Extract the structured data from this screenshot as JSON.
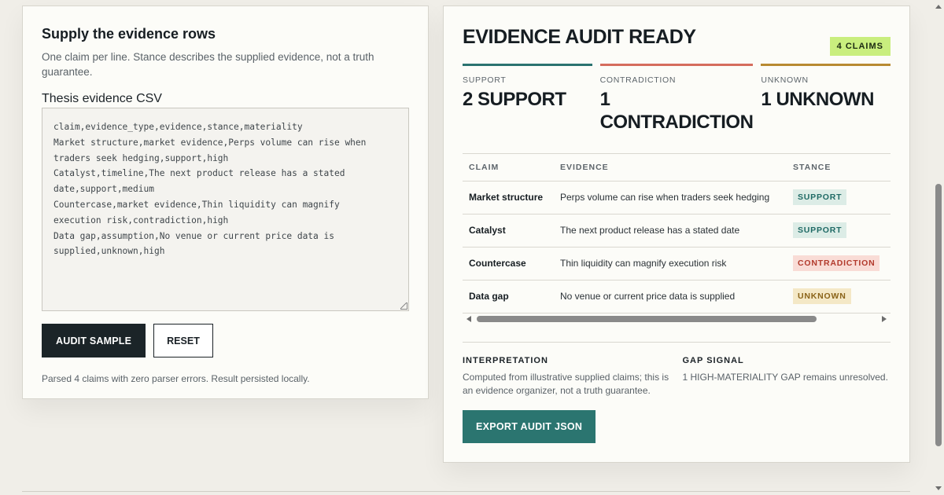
{
  "input_panel": {
    "title": "Supply the evidence rows",
    "subtitle": "One claim per line. Stance describes the supplied evidence, not a truth guarantee.",
    "field_label": "Thesis evidence CSV",
    "csv_value": "claim,evidence_type,evidence,stance,materiality\nMarket structure,market evidence,Perps volume can rise when\ntraders seek hedging,support,high\nCatalyst,timeline,The next product release has a stated\ndate,support,medium\nCountercase,market evidence,Thin liquidity can magnify\nexecution risk,contradiction,high\nData gap,assumption,No venue or current price data is\nsupplied,unknown,high",
    "audit_button": "AUDIT SAMPLE",
    "reset_button": "RESET",
    "status": "Parsed 4 claims with zero parser errors. Result persisted locally."
  },
  "result_panel": {
    "title": "EVIDENCE AUDIT READY",
    "claims_badge": "4 CLAIMS",
    "stats": [
      {
        "label": "SUPPORT",
        "value": "2 SUPPORT",
        "color": "#2a7370"
      },
      {
        "label": "CONTRADICTION",
        "value": "1 CONTRADICTION",
        "color": "#d56c5d"
      },
      {
        "label": "UNKNOWN",
        "value": "1 UNKNOWN",
        "color": "#b88a32"
      }
    ],
    "table": {
      "headers": [
        "CLAIM",
        "EVIDENCE",
        "STANCE"
      ],
      "rows": [
        {
          "claim": "Market structure",
          "evidence": "Perps volume can rise when traders seek hedging",
          "stance": "SUPPORT"
        },
        {
          "claim": "Catalyst",
          "evidence": "The next product release has a stated date",
          "stance": "SUPPORT"
        },
        {
          "claim": "Countercase",
          "evidence": "Thin liquidity can magnify execution risk",
          "stance": "CONTRADICTION"
        },
        {
          "claim": "Data gap",
          "evidence": "No venue or current price data is supplied",
          "stance": "UNKNOWN"
        }
      ]
    },
    "interpretation": {
      "heading": "INTERPRETATION",
      "text": "Computed from illustrative supplied claims; this is an evidence organizer, not a truth guarantee."
    },
    "gap_signal": {
      "heading": "GAP SIGNAL",
      "text": "1 HIGH-MATERIALITY GAP remains unresolved."
    },
    "export_button": "EXPORT AUDIT JSON"
  }
}
